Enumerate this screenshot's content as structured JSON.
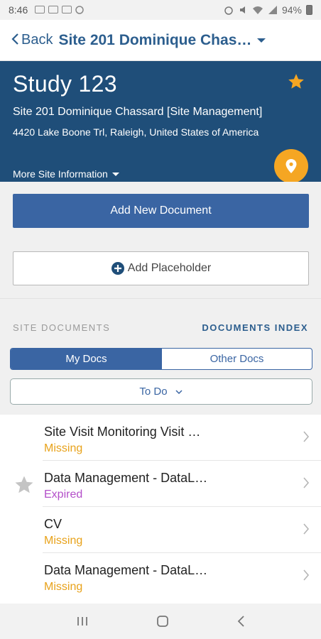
{
  "status_bar": {
    "time": "8:46",
    "battery": "94%"
  },
  "nav": {
    "back_label": "Back",
    "title": "Site 201 Dominique Chas…"
  },
  "header": {
    "study_title": "Study 123",
    "site_name": "Site 201 Dominique Chassard [Site Management]",
    "address": "4420 Lake Boone Trl, Raleigh, United States of America",
    "more_info": "More Site Information"
  },
  "actions": {
    "add_document": "Add New Document",
    "add_placeholder": "Add Placeholder"
  },
  "section": {
    "left": "SITE DOCUMENTS",
    "right": "DOCUMENTS INDEX"
  },
  "tabs": {
    "my_docs": "My Docs",
    "other_docs": "Other Docs"
  },
  "filter": {
    "value": "To Do"
  },
  "documents": [
    {
      "title": "Site Visit Monitoring Visit …",
      "status": "Missing",
      "status_color": "#e8a21a",
      "starred": false
    },
    {
      "title": "Data Management - DataL…",
      "status": "Expired",
      "status_color": "#b34fc9",
      "starred": true
    },
    {
      "title": "CV",
      "status": "Missing",
      "status_color": "#e8a21a",
      "starred": false
    },
    {
      "title": "Data Management - DataL…",
      "status": "Missing",
      "status_color": "#e8a21a",
      "starred": false
    }
  ],
  "colors": {
    "brand": "#1f4e79",
    "accent": "#f5a623",
    "primary_button": "#3a65a3"
  }
}
